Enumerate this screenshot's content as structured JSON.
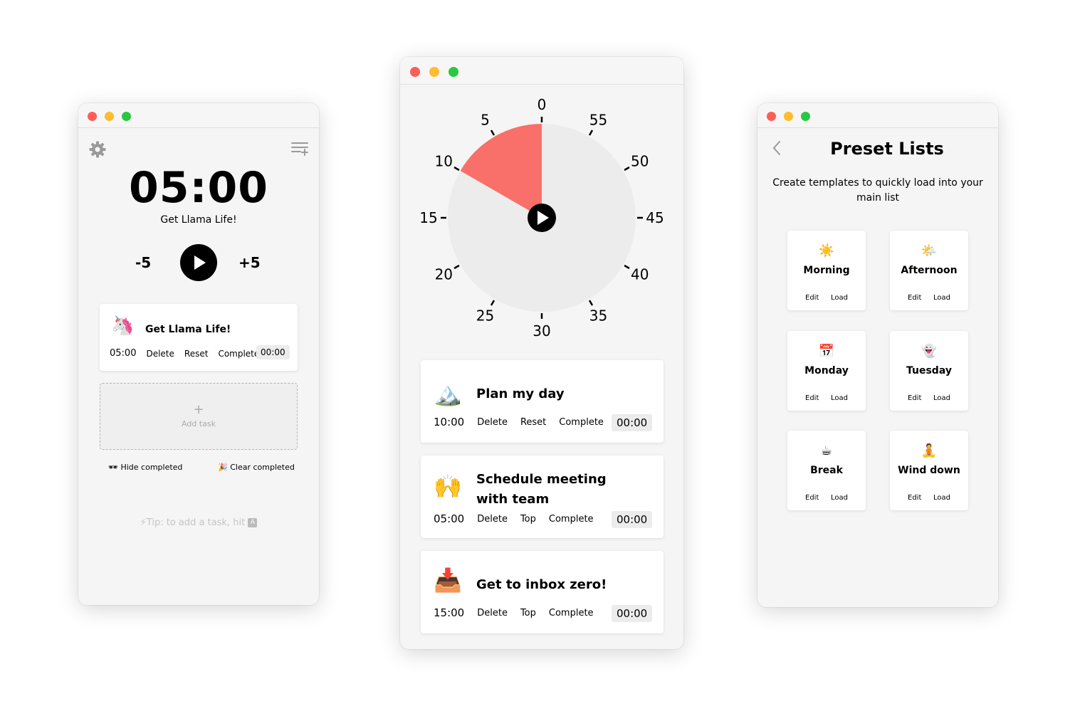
{
  "colors": {
    "accent": "#f87069",
    "dial_face": "#ececec",
    "background": "#f5f5f5",
    "card": "#ffffff"
  },
  "timer_window": {
    "settings_icon": "gear-icon",
    "list_icon": "list-add-icon",
    "time": "05:00",
    "task_title": "Get Llama Life!",
    "minus_label": "-5",
    "plus_label": "+5",
    "task": {
      "emoji": "🦄",
      "title": "Get Llama Life!",
      "duration": "05:00",
      "actions": [
        "Delete",
        "Reset",
        "Complete"
      ],
      "elapsed": "00:00"
    },
    "add_task_label": "Add task",
    "add_task_plus": "+",
    "hide_completed_icon": "🕶",
    "hide_completed": "Hide completed",
    "clear_completed_icon": "🎉",
    "clear_completed": "Clear completed",
    "tip_icon": "⚡",
    "tip": "Tip: to add a task, hit",
    "tip_key": "A"
  },
  "dial_window": {
    "remaining_fraction": 0.1667,
    "tick_labels": [
      "0",
      "5",
      "10",
      "15",
      "20",
      "25",
      "30",
      "35",
      "40",
      "45",
      "50",
      "55"
    ],
    "tasks": [
      {
        "emoji": "🏔️",
        "title_lines": [
          "Plan my day"
        ],
        "duration": "10:00",
        "actions": [
          "Delete",
          "Reset",
          "Complete"
        ],
        "elapsed": "00:00"
      },
      {
        "emoji": "🙌",
        "title_lines": [
          "Schedule meeting",
          "with team"
        ],
        "duration": "05:00",
        "actions": [
          "Delete",
          "Top",
          "Complete"
        ],
        "elapsed": "00:00"
      },
      {
        "emoji": "📥",
        "title_lines": [
          "Get to inbox zero!"
        ],
        "duration": "15:00",
        "actions": [
          "Delete",
          "Top",
          "Complete"
        ],
        "elapsed": "00:00"
      }
    ]
  },
  "presets_window": {
    "back_icon": "chevron-left-icon",
    "title": "Preset Lists",
    "description": "Create templates to quickly load into your main list",
    "edit_label": "Edit",
    "load_label": "Load",
    "presets": [
      {
        "emoji": "☀️",
        "name": "Morning"
      },
      {
        "emoji": "🌤️",
        "name": "Afternoon"
      },
      {
        "emoji": "📅",
        "name": "Monday"
      },
      {
        "emoji": "👻",
        "name": "Tuesday"
      },
      {
        "emoji": "☕",
        "name": "Break"
      },
      {
        "emoji": "🧘",
        "name": "Wind down"
      }
    ]
  }
}
